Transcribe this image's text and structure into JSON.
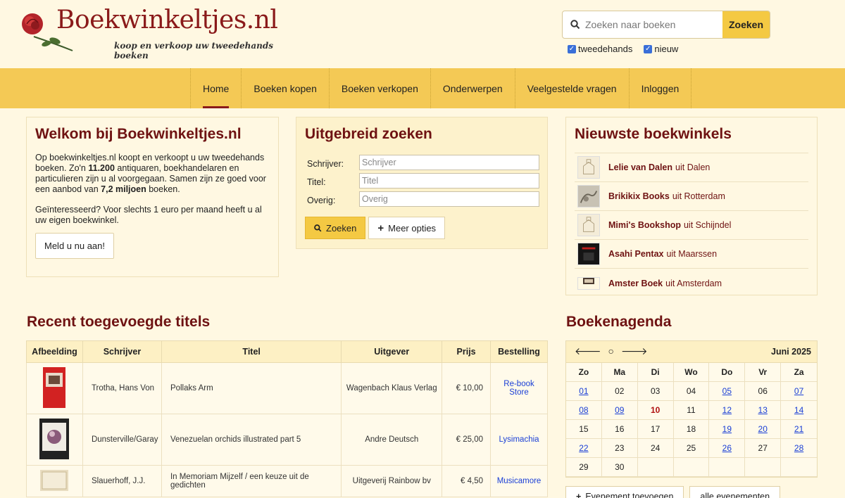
{
  "header": {
    "logo_title": "Boekwinkeltjes.nl",
    "logo_tagline": "koop en verkoop uw tweedehands boeken",
    "search_placeholder": "Zoeken naar boeken",
    "search_button": "Zoeken",
    "filter_tweedehands": "tweedehands",
    "filter_nieuw": "nieuw"
  },
  "nav": {
    "items": [
      "Home",
      "Boeken kopen",
      "Boeken verkopen",
      "Onderwerpen",
      "Veelgestelde vragen",
      "Inloggen"
    ]
  },
  "welcome": {
    "title": "Welkom bij Boekwinkeltjes.nl",
    "p1_a": "Op boekwinkeltjes.nl koopt en verkoopt u uw tweedehands boeken. Zo'n ",
    "p1_b": "11.200",
    "p1_c": " antiquaren, boekhandelaren en particulieren zijn u al voorgegaan. Samen zijn ze goed voor een aanbod van ",
    "p1_d": "7,2 miljoen",
    "p1_e": " boeken.",
    "p2": "Geïnteresseerd? Voor slechts 1 euro per maand heeft u al uw eigen boekwinkel.",
    "button": "Meld u nu aan!"
  },
  "advanced": {
    "title": "Uitgebreid zoeken",
    "author_label": "Schrijver:",
    "author_placeholder": "Schrijver",
    "title_label": "Titel:",
    "title_placeholder": "Titel",
    "other_label": "Overig:",
    "other_placeholder": "Overig",
    "search_button": "Zoeken",
    "more_button": "Meer opties"
  },
  "newest": {
    "title": "Nieuwste boekwinkels",
    "shops": [
      {
        "name": "Lelie van Dalen",
        "city": "uit Dalen"
      },
      {
        "name": "Brikikix Books",
        "city": "uit Rotterdam"
      },
      {
        "name": "Mimi's Bookshop",
        "city": "uit Schijndel"
      },
      {
        "name": "Asahi Pentax",
        "city": "uit Maarssen"
      },
      {
        "name": "Amster Boek",
        "city": "uit Amsterdam"
      }
    ]
  },
  "recent": {
    "title": "Recent toegevoegde titels",
    "columns": [
      "Afbeelding",
      "Schrijver",
      "Titel",
      "Uitgever",
      "Prijs",
      "Bestelling"
    ],
    "rows": [
      {
        "author": "Trotha, Hans Von",
        "title": "Pollaks Arm",
        "publisher": "Wagenbach Klaus Verlag",
        "price": "€ 10,00",
        "shop": "Re-book Store"
      },
      {
        "author": "Dunsterville/Garay",
        "title": "Venezuelan orchids illustrated part 5",
        "publisher": "Andre Deutsch",
        "price": "€ 25,00",
        "shop": "Lysimachia"
      },
      {
        "author": "Slauerhoff, J.J.",
        "title": "In Memoriam Mijzelf / een keuze uit de gedichten",
        "publisher": "Uitgeverij Rainbow bv",
        "price": "€ 4,50",
        "shop": "Musicamore"
      }
    ]
  },
  "agenda": {
    "title": "Boekenagenda",
    "month": "Juni 2025",
    "dow": [
      "Zo",
      "Ma",
      "Di",
      "Wo",
      "Do",
      "Vr",
      "Za"
    ],
    "days": [
      {
        "d": "01",
        "t": "link"
      },
      {
        "d": "02",
        "t": ""
      },
      {
        "d": "03",
        "t": ""
      },
      {
        "d": "04",
        "t": ""
      },
      {
        "d": "05",
        "t": "link"
      },
      {
        "d": "06",
        "t": ""
      },
      {
        "d": "07",
        "t": "link"
      },
      {
        "d": "08",
        "t": "link"
      },
      {
        "d": "09",
        "t": "link"
      },
      {
        "d": "10",
        "t": "today"
      },
      {
        "d": "11",
        "t": ""
      },
      {
        "d": "12",
        "t": "link"
      },
      {
        "d": "13",
        "t": "link"
      },
      {
        "d": "14",
        "t": "link"
      },
      {
        "d": "15",
        "t": ""
      },
      {
        "d": "16",
        "t": ""
      },
      {
        "d": "17",
        "t": ""
      },
      {
        "d": "18",
        "t": ""
      },
      {
        "d": "19",
        "t": "link"
      },
      {
        "d": "20",
        "t": "link"
      },
      {
        "d": "21",
        "t": "link"
      },
      {
        "d": "22",
        "t": "link"
      },
      {
        "d": "23",
        "t": ""
      },
      {
        "d": "24",
        "t": ""
      },
      {
        "d": "25",
        "t": ""
      },
      {
        "d": "26",
        "t": "link"
      },
      {
        "d": "27",
        "t": ""
      },
      {
        "d": "28",
        "t": "link"
      },
      {
        "d": "29",
        "t": ""
      },
      {
        "d": "30",
        "t": ""
      },
      {
        "d": "",
        "t": ""
      },
      {
        "d": "",
        "t": ""
      },
      {
        "d": "",
        "t": ""
      },
      {
        "d": "",
        "t": ""
      },
      {
        "d": "",
        "t": ""
      }
    ],
    "add_event": "Evenement toevoegen",
    "all_events": "alle evenementen"
  },
  "colors": {
    "brand": "#6e1212",
    "accent": "#f4c955",
    "link": "#1a3fd6"
  }
}
